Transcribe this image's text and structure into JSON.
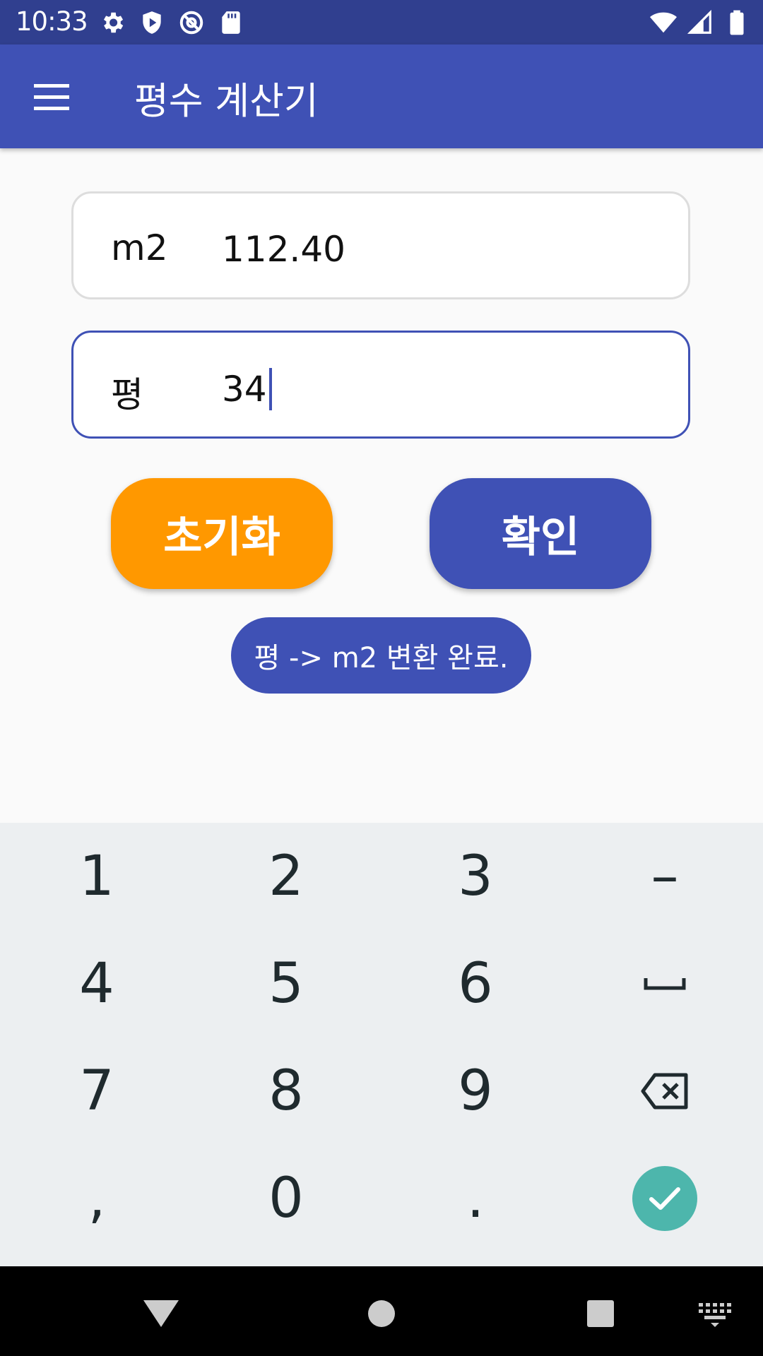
{
  "status_bar": {
    "time": "10:33",
    "icons_left": [
      "settings-icon",
      "shield-icon",
      "at-sign-icon",
      "sd-card-icon"
    ],
    "icons_right": [
      "wifi-icon",
      "cell-signal-icon",
      "battery-icon"
    ]
  },
  "app_bar": {
    "title": "평수 계산기",
    "menu_icon": "menu-icon"
  },
  "fields": {
    "m2": {
      "label": "m2",
      "value": "112.40"
    },
    "pyeong": {
      "label": "평",
      "value": "34"
    }
  },
  "buttons": {
    "reset": "초기화",
    "confirm": "확인"
  },
  "toast": "평 -> m2 변환 완료.",
  "keyboard": {
    "keys": [
      "1",
      "2",
      "3",
      "–",
      "4",
      "5",
      "6",
      "space",
      "7",
      "8",
      "9",
      "backspace",
      ",",
      "0",
      ".",
      "done"
    ],
    "labels": {
      "k1": "1",
      "k2": "2",
      "k3": "3",
      "dash": "–",
      "k4": "4",
      "k5": "5",
      "k6": "6",
      "k7": "7",
      "k8": "8",
      "k9": "9",
      "comma": ",",
      "k0": "0",
      "period": "."
    }
  },
  "nav_bar": {
    "buttons": [
      "back-icon",
      "home-icon",
      "recents-icon",
      "keyboard-switch-icon"
    ]
  },
  "colors": {
    "primary": "#3f51b5",
    "primary_dark": "#303f8f",
    "accent": "#ff9800",
    "done": "#4db6ac"
  }
}
